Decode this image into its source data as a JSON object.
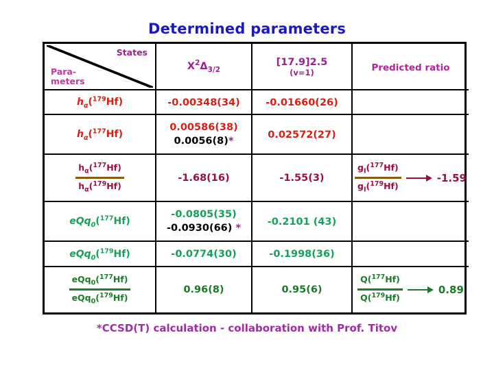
{
  "slide": {
    "title": "Determined parameters",
    "footnote": "*CCSD(T) calculation - collaboration with Prof. Titov"
  },
  "colors": {
    "title": "#1a18c8",
    "header_text": "#9b2193",
    "row_red": "#d81f13",
    "row_darkred": "#9c0f3c",
    "row_green": "#17a05a",
    "row_darkgreen": "#1d7a26",
    "footnote": "#a32aa8",
    "fraction_bar_brown": "#8a5a12",
    "fraction_bar_green": "#1d7a26",
    "asterisk": "#9b2193"
  },
  "table": {
    "corner": {
      "states_label": "States",
      "parameters_line1": "Para-",
      "parameters_line2": "meters"
    },
    "columns": [
      {
        "id": "parameters",
        "label": ""
      },
      {
        "id": "x2delta",
        "base": "X",
        "sup": "2",
        "greek": "Δ",
        "sub": "3/2",
        "label": "X2Δ3/2"
      },
      {
        "id": "state_17_9",
        "line1": "[17.9]2.5",
        "line2": "(v=1)"
      },
      {
        "id": "predicted_ratio",
        "label": "Predicted ratio"
      }
    ],
    "rows": [
      {
        "id": "h-alpha-179",
        "label": {
          "base": "h",
          "basesub": "α",
          "open": "(",
          "sup": "179",
          "tail": "Hf)"
        },
        "color": "red",
        "x2delta": {
          "primary": "-0.00348(34)"
        },
        "state_17_9": {
          "primary": "-0.01660(26)"
        },
        "predicted_ratio": null
      },
      {
        "id": "h-alpha-177",
        "label": {
          "base": "h",
          "basesub": "α",
          "open": "(",
          "sup": "177",
          "tail": "Hf)"
        },
        "color": "red",
        "x2delta": {
          "primary": "0.00586(38)",
          "secondary": "0.0056(8)",
          "secondary_star": "*"
        },
        "state_17_9": {
          "primary": "0.02572(27)"
        },
        "predicted_ratio": null
      },
      {
        "id": "h-alpha-ratio",
        "fraction": {
          "numerator": {
            "base": "h",
            "basesub": "α",
            "open": "(",
            "sup": "177",
            "tail": "Hf)"
          },
          "denominator": {
            "base": "h",
            "basesub": "α",
            "open": "(",
            "sup": "179",
            "tail": "Hf)"
          }
        },
        "color": "dkred",
        "x2delta": {
          "primary": "-1.68(16)"
        },
        "state_17_9": {
          "primary": "-1.55(3)"
        },
        "predicted_ratio": {
          "numerator": {
            "base": "g",
            "basesub": "I",
            "open": "(",
            "sup": "177",
            "tail": "Hf)"
          },
          "denominator": {
            "base": "g",
            "basesub": "I",
            "open": "(",
            "sup": "179",
            "tail": "Hf)"
          },
          "value": "-1.59"
        }
      },
      {
        "id": "eQq0-177",
        "label": {
          "base": "eQq",
          "basesub": "0",
          "open": "(",
          "sup": "177",
          "tail": "Hf)"
        },
        "color": "green",
        "x2delta": {
          "primary": "-0.0805(35)",
          "secondary": "-0.0930(66)",
          "secondary_star": "*"
        },
        "state_17_9": {
          "primary": "-0.2101 (43)"
        },
        "predicted_ratio": null
      },
      {
        "id": "eQq0-179",
        "label": {
          "base": "eQq",
          "basesub": "0",
          "open": "(",
          "sup": "179",
          "tail": "Hf)"
        },
        "color": "green",
        "x2delta": {
          "primary": "-0.0774(30)"
        },
        "state_17_9": {
          "primary": "-0.1998(36)"
        },
        "predicted_ratio": null
      },
      {
        "id": "eQq0-ratio",
        "fraction": {
          "numerator": {
            "base": "eQq",
            "basesub": "0",
            "open": "(",
            "sup": "177",
            "tail": "Hf)"
          },
          "denominator": {
            "base": "eQq",
            "basesub": "0",
            "open": "(",
            "sup": "179",
            "tail": "Hf)"
          }
        },
        "color": "dkgreen",
        "x2delta": {
          "primary": "0.96(8)"
        },
        "state_17_9": {
          "primary": "0.95(6)"
        },
        "predicted_ratio": {
          "numerator": {
            "base": "Q",
            "basesub": "",
            "open": "(",
            "sup": "177",
            "tail": "Hf)"
          },
          "denominator": {
            "base": "Q",
            "basesub": "",
            "open": "(",
            "sup": "179",
            "tail": "Hf)"
          },
          "value": "0.89"
        }
      }
    ]
  }
}
